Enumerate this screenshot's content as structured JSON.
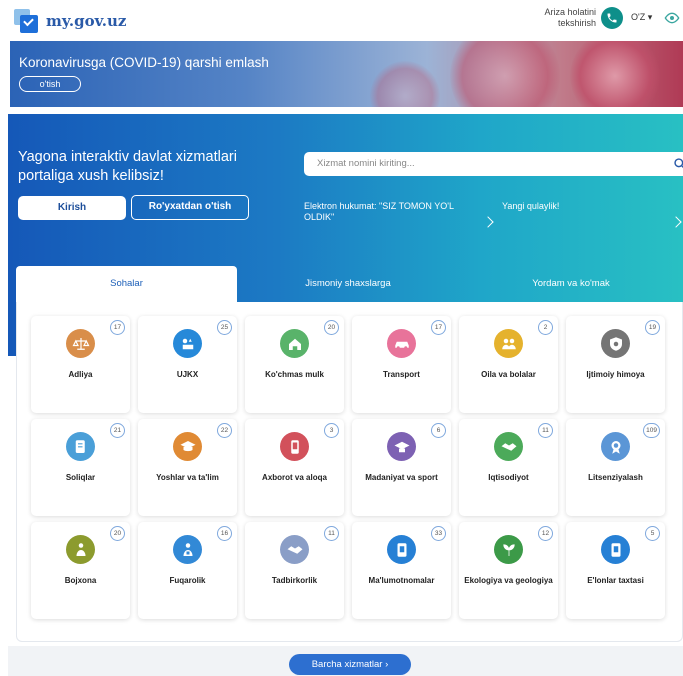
{
  "header": {
    "logo_text": "my.gov.uz",
    "status_link": "Ariza holatini tekshirish",
    "lang": "O'Z",
    "brand_color": "#2a5aa8",
    "accent_color": "#0e8f8a"
  },
  "covid_banner": {
    "title": "Koronavirusga (COVID-19) qarshi emlash",
    "button": "o'tish"
  },
  "hero": {
    "title": "Yagona interaktiv davlat xizmatlari portaliga xush kelibsiz!",
    "login_button": "Kirish",
    "register_button": "Ro'yxatdan o'tish",
    "search_placeholder": "Xizmat nomini kiriting...",
    "news": [
      {
        "text": "Elektron hukumat: \"SIZ TOMON YO'L OLDIK\""
      },
      {
        "text": "Yangi qulaylik!"
      }
    ]
  },
  "tabs": [
    {
      "label": "Sohalar",
      "active": true
    },
    {
      "label": "Jismoniy shaxslarga",
      "active": false
    },
    {
      "label": "Yordam va ko'mak",
      "active": false
    }
  ],
  "categories": [
    {
      "label": "Adliya",
      "count": "17",
      "icon": "scales-icon",
      "color": "#d98e4a"
    },
    {
      "label": "UJKX",
      "count": "25",
      "icon": "utilities-icon",
      "color": "#2689d9"
    },
    {
      "label": "Ko'chmas mulk",
      "count": "20",
      "icon": "house-icon",
      "color": "#59b36a"
    },
    {
      "label": "Transport",
      "count": "17",
      "icon": "car-icon",
      "color": "#e8739a"
    },
    {
      "label": "Oila va bolalar",
      "count": "2",
      "icon": "family-icon",
      "color": "#e5b22d"
    },
    {
      "label": "Ijtimoiy himoya",
      "count": "19",
      "icon": "shield-icon",
      "color": "#757575"
    },
    {
      "label": "Soliqlar",
      "count": "21",
      "icon": "tax-icon",
      "color": "#4a9fd8"
    },
    {
      "label": "Yoshlar va ta'lim",
      "count": "22",
      "icon": "graduation-cap-icon",
      "color": "#e08a34"
    },
    {
      "label": "Axborot va aloqa",
      "count": "3",
      "icon": "phone-icon",
      "color": "#d2515b"
    },
    {
      "label": "Madaniyat va sport",
      "count": "6",
      "icon": "education-icon",
      "color": "#7d61b3"
    },
    {
      "label": "Iqtisodiyot",
      "count": "11",
      "icon": "handshake-icon",
      "color": "#4caa5a"
    },
    {
      "label": "Litsenziyalash",
      "count": "109",
      "icon": "license-icon",
      "color": "#5b96d6"
    },
    {
      "label": "Bojxona",
      "count": "20",
      "icon": "customs-icon",
      "color": "#8c9b2e"
    },
    {
      "label": "Fuqarolik",
      "count": "16",
      "icon": "citizen-icon",
      "color": "#3289d6"
    },
    {
      "label": "Tadbirkorlik",
      "count": "11",
      "icon": "business-icon",
      "color": "#8a9ec7"
    },
    {
      "label": "Ma'lumotnomalar",
      "count": "33",
      "icon": "document-icon",
      "color": "#2680d5"
    },
    {
      "label": "Ekologiya va geologiya",
      "count": "12",
      "icon": "ecology-icon",
      "color": "#3c9a48"
    },
    {
      "label": "E'lonlar taxtasi",
      "count": "5",
      "icon": "board-icon",
      "color": "#2680d5"
    }
  ],
  "footer": {
    "all_services_button": "Barcha xizmatlar ›"
  }
}
